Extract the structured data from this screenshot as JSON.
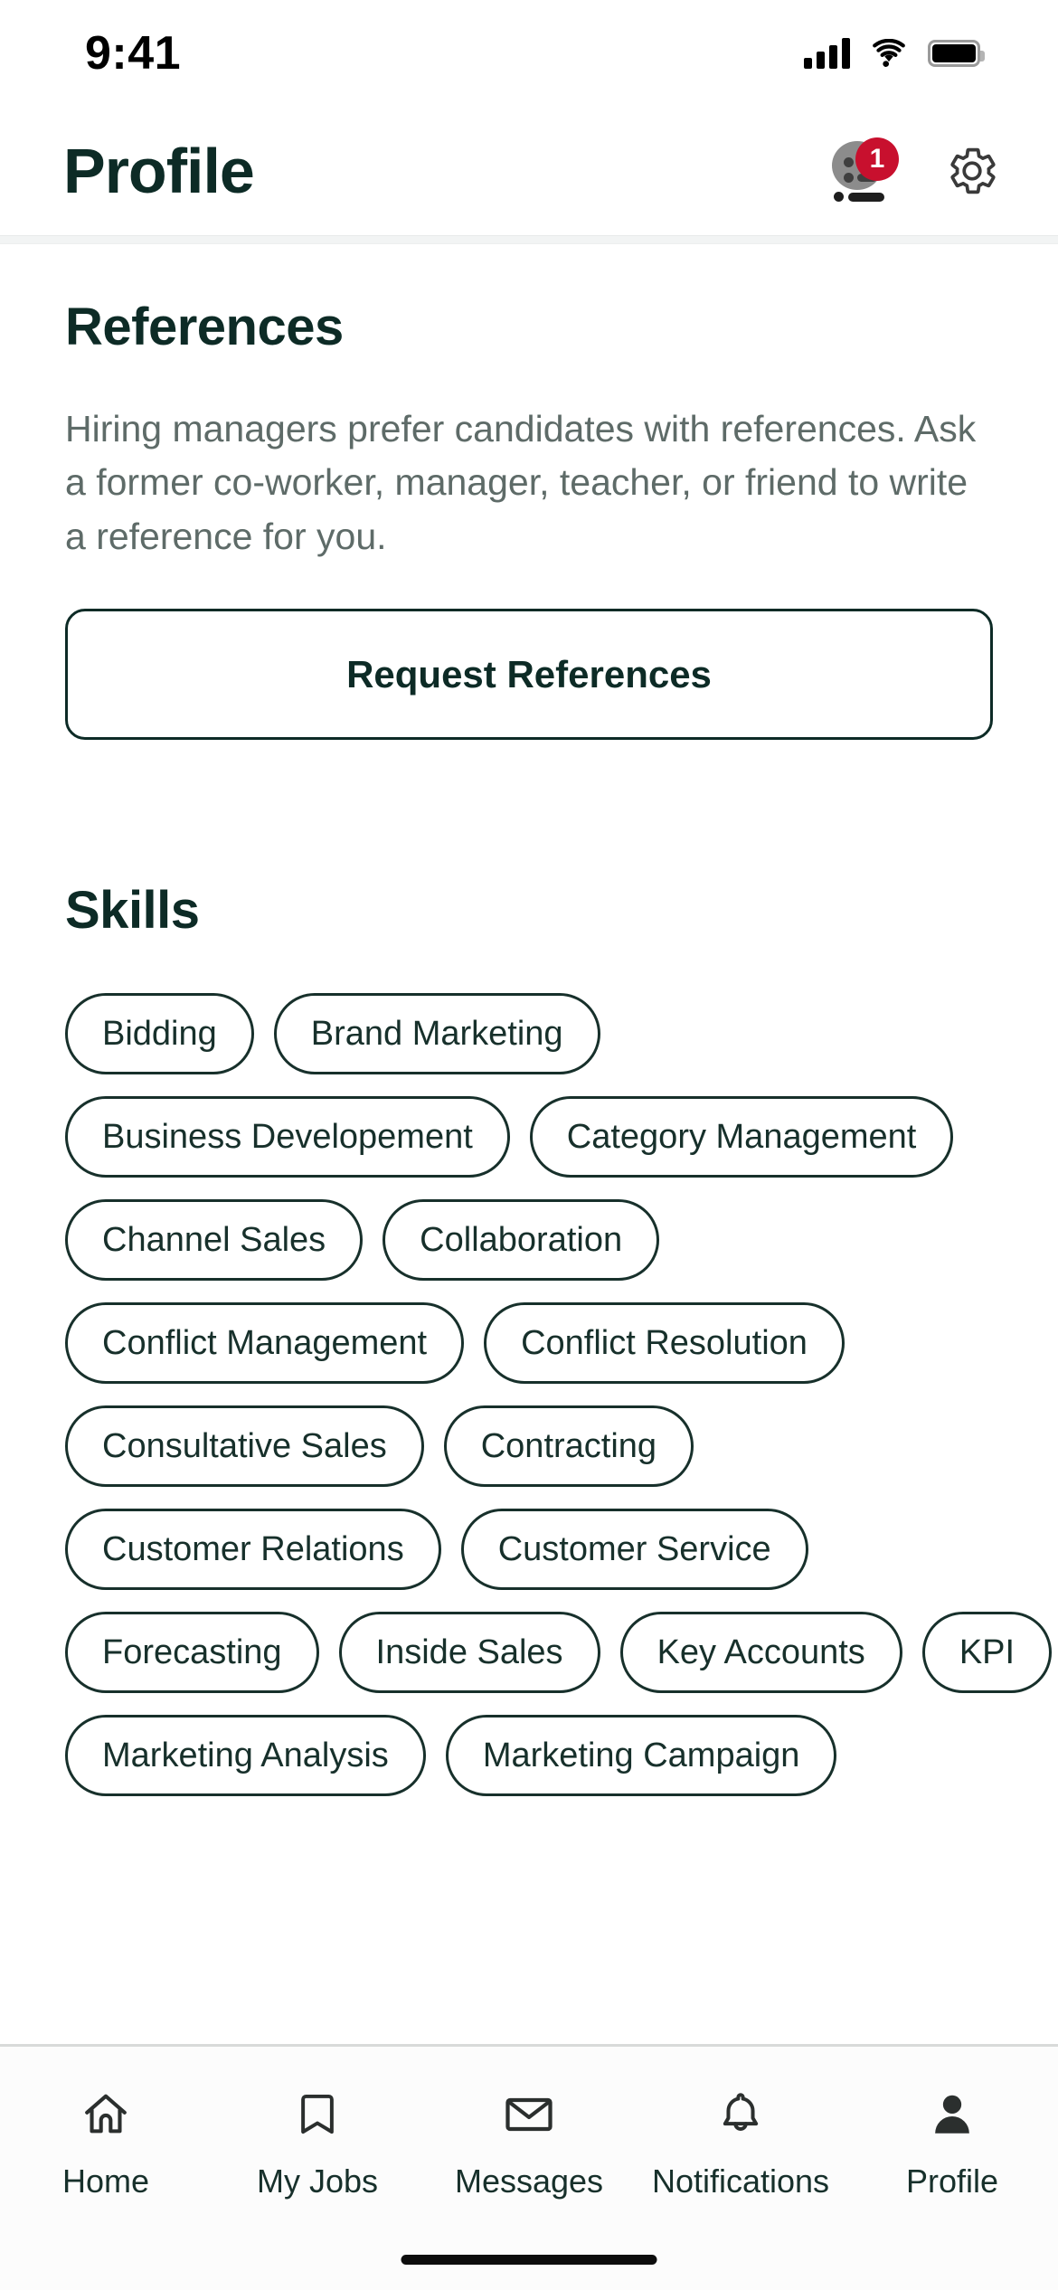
{
  "status_bar": {
    "time": "9:41",
    "cellular_icon": "cellular-signal-icon",
    "wifi_icon": "wifi-icon",
    "battery_icon": "battery-full-icon"
  },
  "header": {
    "title": "Profile",
    "messages_icon": "chat-avatar-icon",
    "messages_badge_count": "1",
    "settings_icon": "gear-icon",
    "badge_color": "#c8102e",
    "title_color": "#0d2b26"
  },
  "references": {
    "title": "References",
    "body": "Hiring managers prefer candidates with references. Ask a former co-worker, manager, teacher, or friend to write a reference for you.",
    "button_label": "Request References"
  },
  "skills": {
    "title": "Skills",
    "items": [
      "Bidding",
      "Brand Marketing",
      "Business Developement",
      "Category Management",
      "Channel Sales",
      "Collaboration",
      "Conflict Management",
      "Conflict Resolution",
      "Consultative Sales",
      "Contracting",
      "Customer Relations",
      "Customer Service",
      "Forecasting",
      "Inside Sales",
      "Key Accounts",
      "KPI",
      "Marketing Analysis",
      "Marketing Campaign"
    ]
  },
  "tab_bar": {
    "items": [
      {
        "label": "Home",
        "icon": "home-icon",
        "active": false
      },
      {
        "label": "My Jobs",
        "icon": "bookmark-icon",
        "active": false
      },
      {
        "label": "Messages",
        "icon": "envelope-icon",
        "active": false
      },
      {
        "label": "Notifications",
        "icon": "bell-icon",
        "active": false
      },
      {
        "label": "Profile",
        "icon": "person-filled-icon",
        "active": true
      }
    ]
  }
}
